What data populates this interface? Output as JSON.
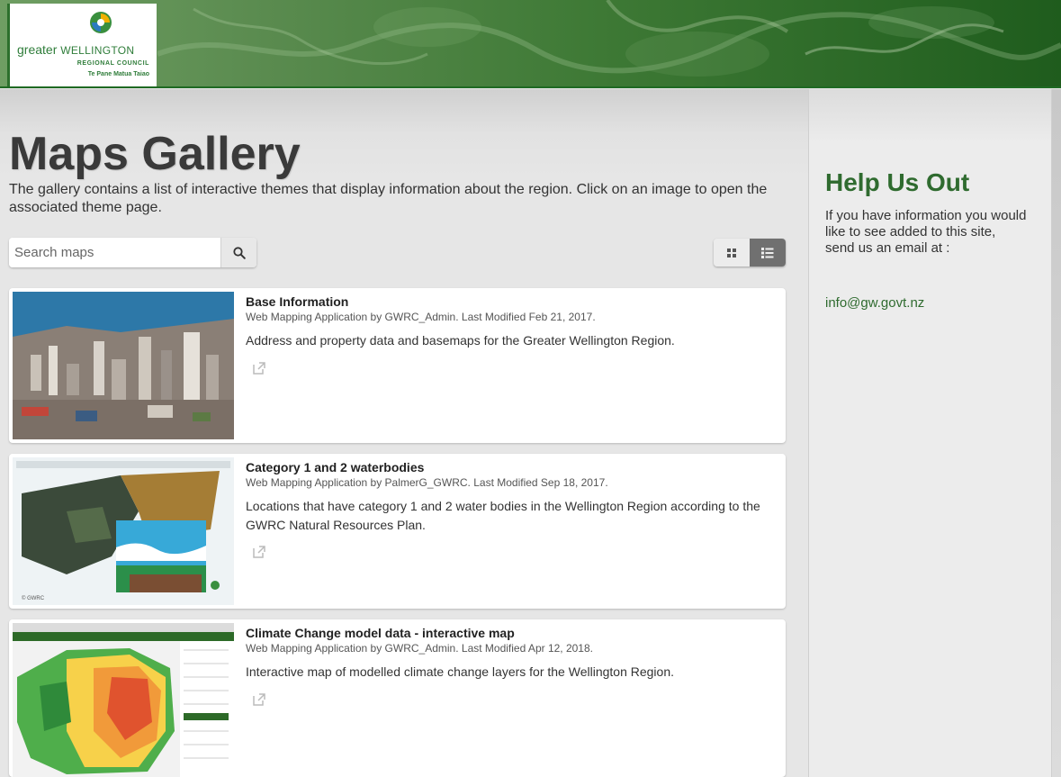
{
  "header": {
    "logo_primary": "greater",
    "logo_secondary": "WELLINGTON",
    "logo_sub1": "REGIONAL COUNCIL",
    "logo_sub2": "Te Pane Matua Taiao",
    "logo_icon": "gwrc-swirl-icon"
  },
  "main": {
    "title": "Maps Gallery",
    "description": "The gallery contains a list of interactive themes that display information about the region. Click on an image to open the associated theme page.",
    "search": {
      "placeholder": "Search maps",
      "icon": "search-icon"
    },
    "view_toggle": {
      "grid_icon": "grid-view-icon",
      "list_icon": "list-view-icon",
      "active": "list"
    }
  },
  "cards": [
    {
      "title": "Base Information",
      "meta": "Web Mapping Application by GWRC_Admin. Last Modified Feb 21, 2017.",
      "description": "Address and property data and basemaps for the Greater Wellington Region.",
      "icon": "external-link-icon"
    },
    {
      "title": "Category 1 and 2 waterbodies",
      "meta": "Web Mapping Application by PalmerG_GWRC. Last Modified Sep 18, 2017.",
      "description": "Locations that have category 1 and 2 water bodies in the Wellington Region according to the GWRC Natural Resources Plan.",
      "icon": "external-link-icon"
    },
    {
      "title": "Climate Change model data - interactive map",
      "meta": "Web Mapping Application by GWRC_Admin. Last Modified Apr 12, 2018.",
      "description": "Interactive map of modelled climate change layers for the Wellington Region.",
      "icon": "external-link-icon"
    }
  ],
  "sidebar": {
    "title": "Help Us Out",
    "text_line1": "If you have information you would like to see added to this site,",
    "text_line2": "send us an email at :",
    "email": "info@gw.govt.nz"
  },
  "colors": {
    "brand_green": "#2f6b2f",
    "header_dark": "#1f5c1d",
    "toggle_active": "#707070"
  }
}
